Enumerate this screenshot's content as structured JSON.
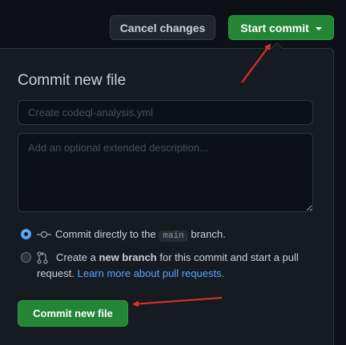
{
  "toolbar": {
    "cancel_label": "Cancel changes",
    "start_commit_label": "Start commit"
  },
  "commit_panel": {
    "title": "Commit new file",
    "summary_placeholder": "Create codeql-analysis.yml",
    "description_placeholder": "Add an optional extended description...",
    "option_direct": {
      "prefix": "Commit directly to the",
      "branch": "main",
      "suffix": "branch.",
      "selected": true
    },
    "option_new_branch": {
      "prefix": "Create a",
      "bold": "new branch",
      "middle": "for this commit and start a pull request.",
      "link": "Learn more about pull requests.",
      "selected": false
    },
    "submit_label": "Commit new file"
  },
  "colors": {
    "background": "#0d1117",
    "panel": "#161b22",
    "border": "#30363d",
    "primary_green": "#238636",
    "link_blue": "#58a6ff",
    "annotation_arrow": "#e5312b"
  }
}
